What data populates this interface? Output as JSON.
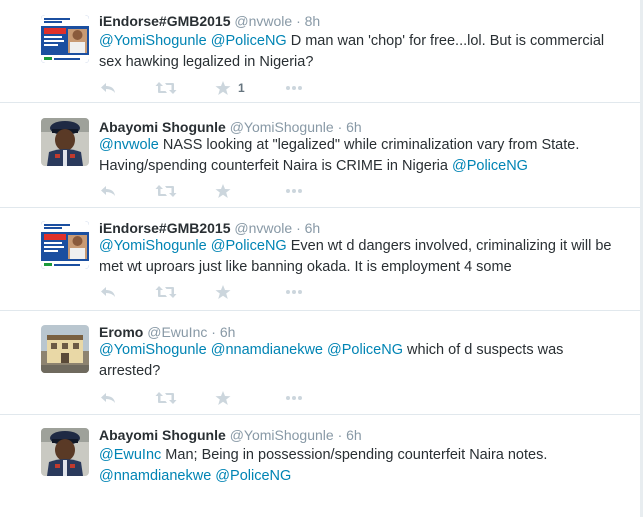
{
  "tweets": [
    {
      "name": "iEndorse#GMB2015",
      "handle": "@nvwole",
      "dot": "·",
      "time": "8h",
      "segments": [
        {
          "t": "@YomiShogunle",
          "m": true
        },
        {
          "t": " ",
          "m": false
        },
        {
          "t": "@PoliceNG",
          "m": true
        },
        {
          "t": " D man wan 'chop' for free...lol. But is commercial sex hawking legalized in Nigeria?",
          "m": false
        }
      ],
      "favorite_count": "1",
      "avatar": "campaign-poster"
    },
    {
      "name": "Abayomi Shogunle",
      "handle": "@YomiShogunle",
      "dot": "·",
      "time": "6h",
      "segments": [
        {
          "t": "@nvwole",
          "m": true
        },
        {
          "t": " NASS looking at \"legalized\" while criminalization vary from State. Having/spending counterfeit Naira is CRIME in Nigeria ",
          "m": false
        },
        {
          "t": "@PoliceNG",
          "m": true
        }
      ],
      "favorite_count": "",
      "avatar": "police-officer"
    },
    {
      "name": "iEndorse#GMB2015",
      "handle": "@nvwole",
      "dot": "·",
      "time": "6h",
      "segments": [
        {
          "t": "@YomiShogunle",
          "m": true
        },
        {
          "t": " ",
          "m": false
        },
        {
          "t": "@PoliceNG",
          "m": true
        },
        {
          "t": " Even wt d dangers involved, criminalizing it will be met wt uproars just like banning okada. It is employment 4 some",
          "m": false
        }
      ],
      "favorite_count": "",
      "avatar": "campaign-poster"
    },
    {
      "name": "Eromo",
      "handle": "@EwuInc",
      "dot": "·",
      "time": "6h",
      "segments": [
        {
          "t": "@YomiShogunle",
          "m": true
        },
        {
          "t": " ",
          "m": false
        },
        {
          "t": "@nnamdianekwe",
          "m": true
        },
        {
          "t": " ",
          "m": false
        },
        {
          "t": "@PoliceNG",
          "m": true
        },
        {
          "t": " which of d suspects was arrested?",
          "m": false
        }
      ],
      "favorite_count": "",
      "avatar": "building-photo"
    },
    {
      "name": "Abayomi Shogunle",
      "handle": "@YomiShogunle",
      "dot": "·",
      "time": "6h",
      "segments": [
        {
          "t": "@EwuInc",
          "m": true
        },
        {
          "t": " Man; Being in possession/spending counterfeit Naira notes. ",
          "m": false
        },
        {
          "t": "@nnamdianekwe",
          "m": true
        },
        {
          "t": " ",
          "m": false
        },
        {
          "t": "@PoliceNG",
          "m": true
        }
      ],
      "favorite_count": "",
      "avatar": "police-officer"
    }
  ],
  "icons": {
    "reply": "reply-icon",
    "retweet": "retweet-icon",
    "favorite": "star-icon",
    "more": "more-icon"
  },
  "colors": {
    "mention": "#0084b4",
    "name": "#292f33",
    "meta": "#8899a6",
    "action_icon": "#ccd6dd",
    "divider": "#e1e8ed"
  }
}
